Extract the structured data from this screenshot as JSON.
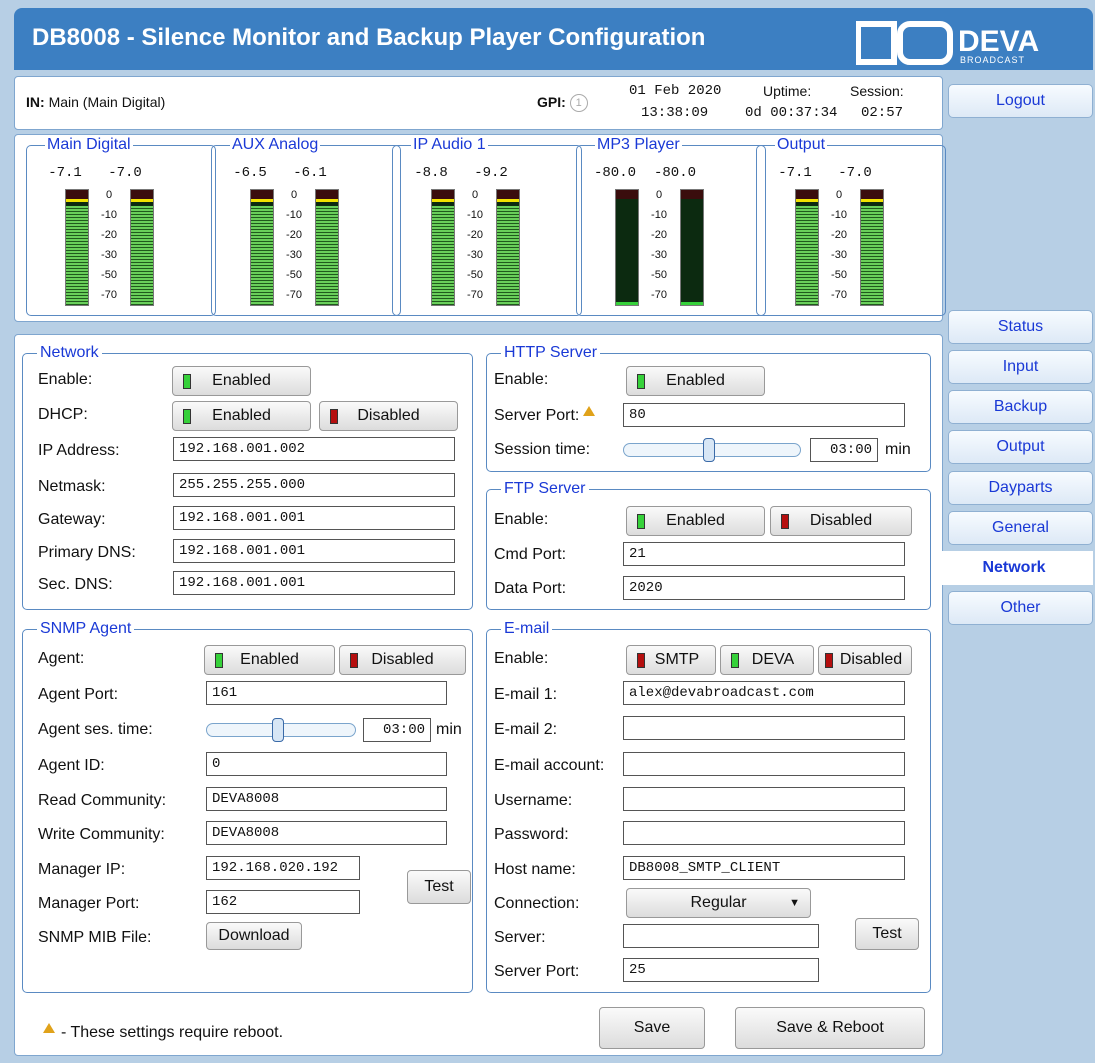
{
  "header": {
    "title": "DB8008 - Silence Monitor and Backup Player Configuration",
    "logo_text": "DEVA",
    "logo_sub": "BROADCAST"
  },
  "info": {
    "in_label": "IN:",
    "in_value": "Main (Main Digital)",
    "gpi_label": "GPI:",
    "gpi_value": "1",
    "date": "01 Feb 2020",
    "time": "13:38:09",
    "uptime_label": "Uptime:",
    "uptime_value": "0d 00:37:34",
    "session_label": "Session:",
    "session_value": "02:57"
  },
  "meters": [
    {
      "name": "Main Digital",
      "left": "-7.1",
      "right": "-7.0",
      "left_level": 0.86,
      "right_level": 0.86,
      "active": true
    },
    {
      "name": "AUX Analog",
      "left": "-6.5",
      "right": "-6.1",
      "left_level": 0.86,
      "right_level": 0.86,
      "active": true
    },
    {
      "name": "IP Audio 1",
      "left": "-8.8",
      "right": "-9.2",
      "left_level": 0.86,
      "right_level": 0.86,
      "active": true
    },
    {
      "name": "MP3 Player",
      "left": "-80.0",
      "right": "-80.0",
      "left_level": 0.02,
      "right_level": 0.0,
      "active": false
    },
    {
      "name": "Output",
      "left": "-7.1",
      "right": "-7.0",
      "left_level": 0.86,
      "right_level": 0.86,
      "active": true
    }
  ],
  "scale": [
    "0",
    "-10",
    "-20",
    "-30",
    "-50",
    "-70"
  ],
  "network": {
    "legend": "Network",
    "enable_label": "Enable:",
    "enable_btn": "Enabled",
    "dhcp_label": "DHCP:",
    "dhcp_on": "Enabled",
    "dhcp_off": "Disabled",
    "ip_label": "IP Address:",
    "ip": "192.168.001.002",
    "mask_label": "Netmask:",
    "mask": "255.255.255.000",
    "gw_label": "Gateway:",
    "gw": "192.168.001.001",
    "dns1_label": "Primary DNS:",
    "dns1": "192.168.001.001",
    "dns2_label": "Sec. DNS:",
    "dns2": "192.168.001.001"
  },
  "http": {
    "legend": "HTTP Server",
    "enable_label": "Enable:",
    "enable_btn": "Enabled",
    "port_label": "Server Port:",
    "port": "80",
    "session_label": "Session time:",
    "session": "03:00",
    "unit": "min",
    "slider_level": 0.48
  },
  "ftp": {
    "legend": "FTP Server",
    "enable_label": "Enable:",
    "on": "Enabled",
    "off": "Disabled",
    "cmd_label": "Cmd Port:",
    "cmd": "21",
    "data_label": "Data Port:",
    "data": "2020"
  },
  "snmp": {
    "legend": "SNMP Agent",
    "agent_label": "Agent:",
    "on": "Enabled",
    "off": "Disabled",
    "port_label": "Agent Port:",
    "port": "161",
    "ses_label": "Agent ses. time:",
    "ses": "03:00",
    "unit": "min",
    "slider_level": 0.48,
    "id_label": "Agent ID:",
    "id": "0",
    "read_label": "Read Community:",
    "read": "DEVA8008",
    "write_label": "Write Community:",
    "write": "DEVA8008",
    "mip_label": "Manager IP:",
    "mip": "192.168.020.192",
    "mport_label": "Manager Port:",
    "mport": "162",
    "test": "Test",
    "mib_label": "SNMP MIB File:",
    "download": "Download"
  },
  "email": {
    "legend": "E-mail",
    "enable_label": "Enable:",
    "smtp": "SMTP",
    "deva": "DEVA",
    "disabled": "Disabled",
    "e1_label": "E-mail 1:",
    "e1": "alex@devabroadcast.com",
    "e2_label": "E-mail 2:",
    "e2": "",
    "acc_label": "E-mail account:",
    "acc": "",
    "user_label": "Username:",
    "user": "",
    "pass_label": "Password:",
    "pass": "",
    "host_label": "Host name:",
    "host": "DB8008_SMTP_CLIENT",
    "conn_label": "Connection:",
    "conn": "Regular",
    "server_label": "Server:",
    "server": "",
    "sport_label": "Server Port:",
    "sport": "25",
    "test": "Test"
  },
  "footer": {
    "note": "- These settings require reboot.",
    "save": "Save",
    "save_reboot": "Save & Reboot"
  },
  "nav": {
    "logout": "Logout",
    "items": [
      "Status",
      "Input",
      "Backup",
      "Output",
      "Dayparts",
      "General",
      "Network",
      "Other"
    ],
    "active": "Network"
  }
}
